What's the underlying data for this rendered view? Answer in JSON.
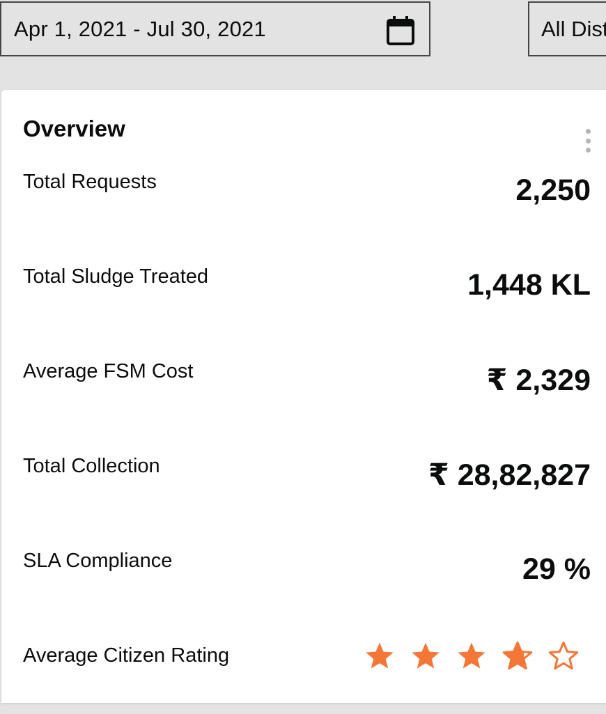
{
  "filters": {
    "date_range": "Apr 1, 2021 - Jul 30, 2021",
    "district": "All Dist"
  },
  "overview": {
    "title": "Overview",
    "metrics": [
      {
        "label": "Total Requests",
        "value": "2,250"
      },
      {
        "label": "Total Sludge Treated",
        "value": "1,448 KL"
      },
      {
        "label": "Average FSM Cost",
        "value": "₹ 2,329"
      },
      {
        "label": "Total Collection",
        "value": "₹ 28,82,827"
      },
      {
        "label": "SLA Compliance",
        "value": "29 %"
      }
    ],
    "rating": {
      "label": "Average Citizen Rating",
      "value": 3.7,
      "max": 5
    }
  },
  "colors": {
    "accent": "#f47738",
    "background": "#e3e3e3",
    "card": "#ffffff",
    "text": "#0b0c0c"
  },
  "icons": {
    "calendar": "calendar-icon",
    "menu": "kebab-menu-icon",
    "rating": "star-icon"
  }
}
